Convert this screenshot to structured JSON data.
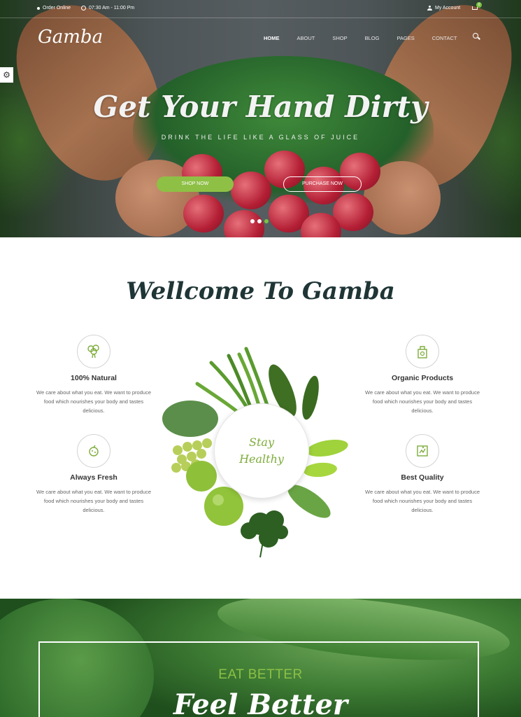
{
  "topbar": {
    "order_online": "Order Online",
    "hours": "07:30 Am - 11:00 Pm",
    "account": "My Account",
    "cart_count": "0"
  },
  "header": {
    "logo": "Gamba",
    "nav": [
      "HOME",
      "ABOUT",
      "SHOP",
      "BLOG",
      "PAGES",
      "CONTACT"
    ]
  },
  "hero": {
    "title": "Get Your Hand Dirty",
    "subtitle": "DRINK THE LIFE LIKE A GLASS OF JUICE",
    "shop_button": "SHOP NOW",
    "purchase_button": "PURCHASE NOW",
    "slides_total": 3,
    "slide_active": 3
  },
  "welcome": {
    "title": "Wellcome To Gamba",
    "center_line1": "Stay",
    "center_line2": "Healthy",
    "features": [
      {
        "icon": "broccoli-icon",
        "title": "100% Natural",
        "desc": "We care about what you eat. We want to produce food which nourishes your body and tastes delicious."
      },
      {
        "icon": "grocery-bag-icon",
        "title": "Organic Products",
        "desc": "We care about what you eat. We want to produce food which nourishes your body and tastes delicious."
      },
      {
        "icon": "fresh-fruit-icon",
        "title": "Always Fresh",
        "desc": "We care about what you eat. We want to produce food which nourishes your body and tastes delicious."
      },
      {
        "icon": "quality-badge-icon",
        "title": "Best Quality",
        "desc": "We care about what you eat. We want to produce food which nourishes your body and tastes delicious."
      }
    ]
  },
  "banner": {
    "eyebrow": "EAT BETTER",
    "headline": "Feel Better"
  },
  "colors": {
    "accent_green": "#8ec045",
    "dark_heading": "#1f3536"
  }
}
